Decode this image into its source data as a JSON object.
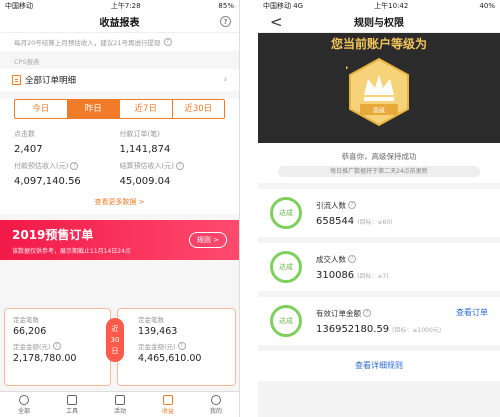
{
  "left": {
    "status": {
      "carrier": "中国移动",
      "time": "上午7:28",
      "battery": "85%"
    },
    "title": "收益报表",
    "help": "?",
    "notice": "每月20号结算上月预估收入，建议21号再进行提现",
    "section_label": "CPS报表",
    "all_orders": "全部订单明细",
    "tabs": [
      "今日",
      "昨日",
      "近7日",
      "近30日"
    ],
    "active_tab": 1,
    "stats": [
      {
        "label": "点击数",
        "value": "2,407",
        "info": false
      },
      {
        "label": "付款订单(笔)",
        "value": "1,141,874",
        "info": false
      },
      {
        "label": "付款预估收入(元)",
        "value": "4,097,140.56",
        "info": true
      },
      {
        "label": "结算预估收入(元)",
        "value": "45,009.04",
        "info": true
      }
    ],
    "more": "查看更多数据 >",
    "banner": {
      "title": "2019预售订单",
      "subtitle": "该数据仅供参考，展示期截止11月14日24点",
      "rule": "规则 >"
    },
    "presale_left": [
      {
        "label": "定金笔数",
        "value": "66,206"
      },
      {
        "label": "定金金额(元)",
        "value": "2,178,780.00"
      }
    ],
    "presale_right": [
      {
        "label": "定金笔数",
        "value": "139,463"
      },
      {
        "label": "定金金额(元)",
        "value": "4,465,610.00"
      }
    ],
    "mid_tag": [
      "近",
      "30",
      "日"
    ],
    "nav": [
      "全部",
      "工具",
      "活动",
      "收益",
      "我的"
    ],
    "active_nav": 3
  },
  "right": {
    "status": {
      "carrier": "中国移动 4G",
      "time": "上午10:42",
      "battery": "40%"
    },
    "title": "规则与权限",
    "back": "<",
    "hero_title": "您当前账户等级为",
    "badge_label": "高级",
    "congrats": "恭喜你，高级保持成功",
    "update": "每日推广数据将于第二天24点前更新",
    "cards": [
      {
        "circle": "达成",
        "name": "引流人数",
        "info": true,
        "value": "658544",
        "target": "(目标：≥60)",
        "link": ""
      },
      {
        "circle": "达成",
        "name": "成交人数",
        "info": true,
        "value": "310086",
        "target": "(目标：≥7)",
        "link": ""
      },
      {
        "circle": "达成",
        "name": "有效订单金额",
        "info": true,
        "value": "136952180.59",
        "target": "(目标：≥1000元)",
        "link": "查看订单"
      }
    ],
    "bottom_link": "查看详细规则"
  },
  "colors": {
    "accent": "#f07c2a",
    "banner": "#f21948",
    "success": "#7fcf5f",
    "link": "#2a6ad2",
    "gold": "#f2c45a"
  }
}
